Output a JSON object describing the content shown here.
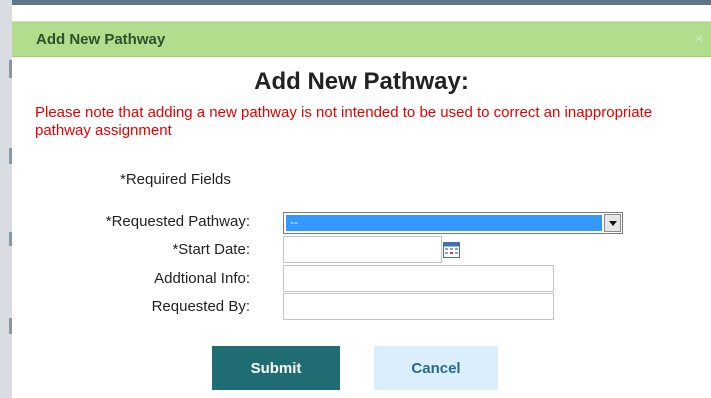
{
  "dialog": {
    "title_bar": "Add New Pathway",
    "close_glyph": "×",
    "heading": "Add New Pathway:",
    "notice": "Please note that adding a new pathway is not intended to be used to correct an inappropriate pathway assignment",
    "required_note": "*Required Fields"
  },
  "form": {
    "requested_pathway": {
      "label": "*Requested Pathway:",
      "selected_value": "--"
    },
    "start_date": {
      "label": "*Start Date:",
      "value": ""
    },
    "additional_info": {
      "label": "Addtional Info:",
      "value": ""
    },
    "requested_by": {
      "label": "Requested By:",
      "value": ""
    }
  },
  "buttons": {
    "submit": "Submit",
    "cancel": "Cancel"
  },
  "icons": {
    "close": "close-icon",
    "calendar": "calendar-icon",
    "dropdown": "chevron-down-icon"
  },
  "colors": {
    "title_bar_bg": "#b1dd8c",
    "notice_text": "#e30000",
    "select_highlight": "#3399ff",
    "submit_bg": "#1f6d73",
    "cancel_bg": "#daeefc"
  }
}
